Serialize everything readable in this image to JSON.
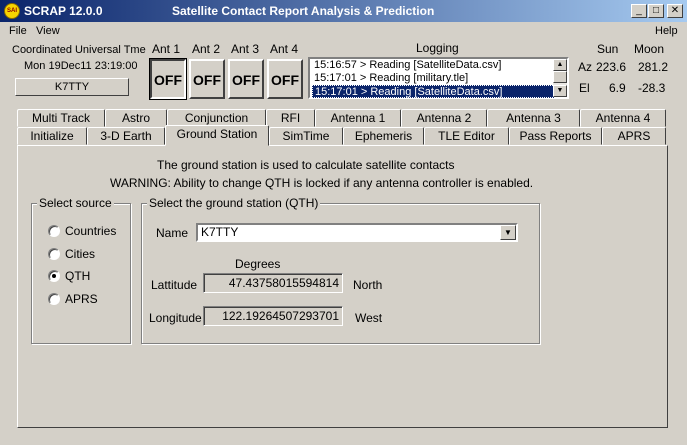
{
  "window": {
    "app_icon_text": "SAI",
    "app_name": "SCRAP  12.0.0",
    "title": "Satellite Contact Report Analysis & Prediction",
    "controls": {
      "minimize": "_",
      "maximize": "□",
      "close": "✕"
    }
  },
  "menu": {
    "file": "File",
    "view": "View",
    "help": "Help"
  },
  "utc": {
    "label": "Coordinated Universal Tme",
    "datetime": "Mon 19Dec11 23:19:00",
    "callsign": "K7TTY"
  },
  "antennas": [
    {
      "label": "Ant 1",
      "state": "OFF"
    },
    {
      "label": "Ant 2",
      "state": "OFF"
    },
    {
      "label": "Ant 3",
      "state": "OFF"
    },
    {
      "label": "Ant 4",
      "state": "OFF"
    }
  ],
  "logging": {
    "label": "Logging",
    "lines": [
      "15:16:57 > Reading [SatelliteData.csv]",
      "15:17:01 > Reading [military.tle]",
      "15:17:01 > Reading [SatelliteData.csv]"
    ]
  },
  "sunmoon": {
    "sun_label": "Sun",
    "moon_label": "Moon",
    "az_label": "Az",
    "el_label": "El",
    "sun_az": "223.6",
    "moon_az": "281.2",
    "sun_el": "6.9",
    "moon_el": "-28.3"
  },
  "tabs_row1": [
    "Multi Track",
    "Astro",
    "Conjunction",
    "RFI",
    "Antenna 1",
    "Antenna 2",
    "Antenna 3",
    "Antenna 4"
  ],
  "tabs_row2": [
    "Initialize",
    "3-D Earth",
    "Ground Station",
    "SimTime",
    "Ephemeris",
    "TLE Editor",
    "Pass Reports",
    "APRS"
  ],
  "active_tab": "Ground Station",
  "panel": {
    "info_line1": "The ground station is used to calculate satellite contacts",
    "info_line2": "WARNING:  Ability to change QTH is locked if any antenna controller is enabled.",
    "source_title": "Select source",
    "sources": [
      "Countries",
      "Cities",
      "QTH",
      "APRS"
    ],
    "selected_source": "QTH",
    "qth_title": "Select the ground station (QTH)",
    "name_label": "Name",
    "name_value": "K7TTY",
    "degrees_label": "Degrees",
    "latitude_label": "Lattitude",
    "latitude_value": "47.43758015594814",
    "latitude_dir": "North",
    "longitude_label": "Longitude",
    "longitude_value": "122.19264507293701",
    "longitude_dir": "West"
  },
  "colors": {
    "face": "#d4d0c8",
    "title_start": "#0a246a",
    "title_end": "#a6caf0",
    "selection": "#0a246a"
  }
}
